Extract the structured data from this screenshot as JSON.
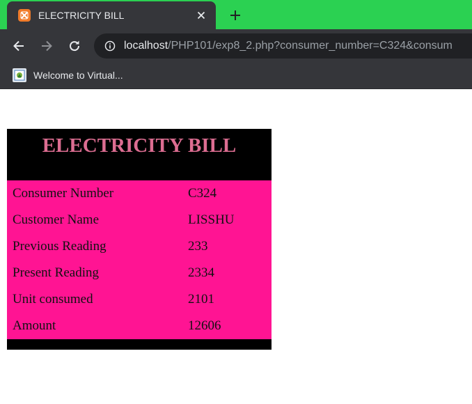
{
  "browser": {
    "tab_title": "ELECTRICITY BILL",
    "url_host": "localhost",
    "url_path": "/PHP101/exp8_2.php?consumer_number=C324&consum",
    "bookmark_label": "Welcome to Virtual...",
    "colors": {
      "tabstrip": "#2bd152",
      "chrome": "#35363a",
      "omnibox": "#202124"
    },
    "icons": [
      "xampp-favicon",
      "close-icon",
      "plus-icon",
      "back-arrow-icon",
      "forward-arrow-icon",
      "reload-icon",
      "info-icon",
      "bookmark-favicon"
    ]
  },
  "bill": {
    "title": "ELECTRICITY BILL",
    "rows": [
      {
        "label": "Consumer Number",
        "value": "C324"
      },
      {
        "label": "Customer Name",
        "value": "LISSHU"
      },
      {
        "label": "Previous Reading",
        "value": "233"
      },
      {
        "label": "Present Reading",
        "value": "2334"
      },
      {
        "label": "Unit consumed",
        "value": "2101"
      },
      {
        "label": "Amount",
        "value": "12606"
      }
    ],
    "colors": {
      "frame": "#000000",
      "title": "#dc6d91",
      "body": "#ff1493"
    }
  }
}
